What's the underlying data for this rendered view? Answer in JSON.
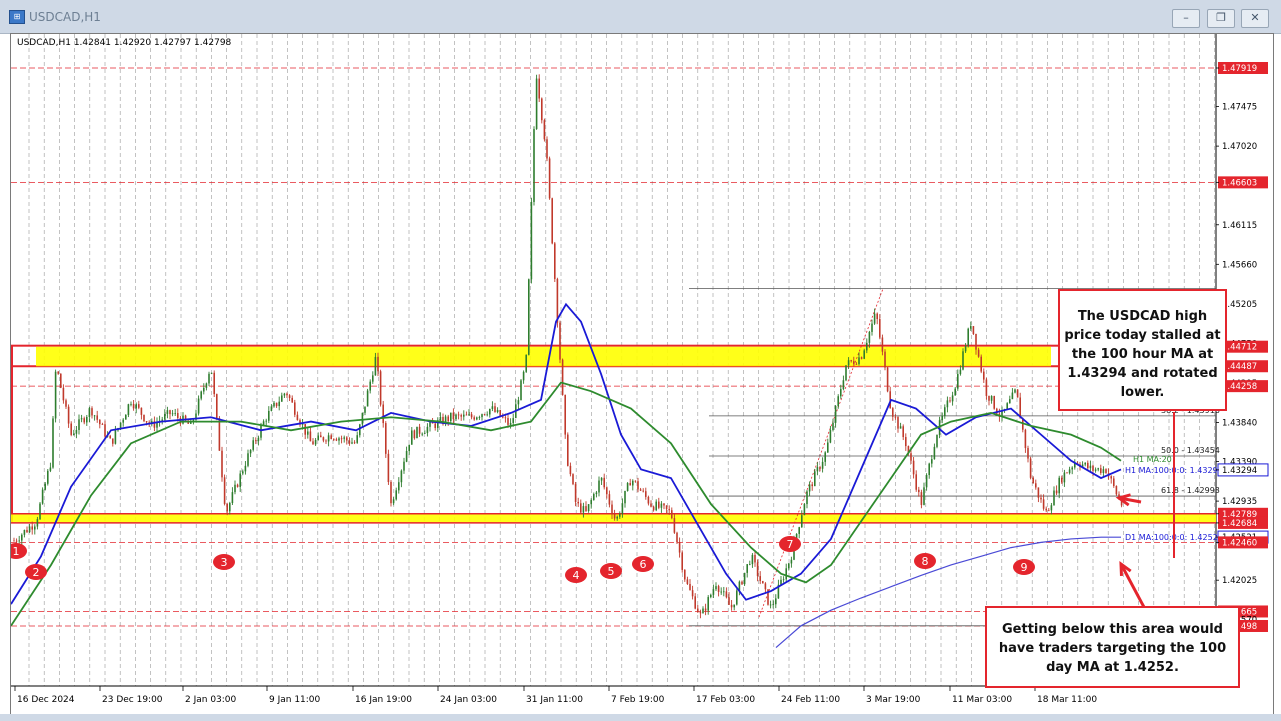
{
  "window": {
    "title": "USDCAD,H1",
    "minimize": "–",
    "restore": "❐",
    "close": "✕"
  },
  "chart": {
    "header": "USDCAD,H1  1.42841 1.42920 1.42797 1.42798",
    "price_axis": [
      {
        "label": "1.47919",
        "price": 1.47919,
        "highlight": "red"
      },
      {
        "label": "1.47475",
        "price": 1.47475
      },
      {
        "label": "1.47020",
        "price": 1.4702
      },
      {
        "label": "1.46603",
        "price": 1.46603,
        "highlight": "red"
      },
      {
        "label": "1.46115",
        "price": 1.46115
      },
      {
        "label": "1.45660",
        "price": 1.4566
      },
      {
        "label": "1.45205",
        "price": 1.45205
      },
      {
        "label": "1.44750",
        "price": 1.4475
      },
      {
        "label": "1.44712",
        "price": 1.44712,
        "highlight": "red"
      },
      {
        "label": "1.44487",
        "price": 1.44487,
        "highlight": "red"
      },
      {
        "label": "1.44295",
        "price": 1.44295
      },
      {
        "label": "1.44258",
        "price": 1.44258,
        "highlight": "red"
      },
      {
        "label": "1.43840",
        "price": 1.4384
      },
      {
        "label": "1.43390",
        "price": 1.4339
      },
      {
        "label": "1.43294",
        "price": 1.43294,
        "highlight": "blue-outline"
      },
      {
        "label": "1.42935",
        "price": 1.42935
      },
      {
        "label": "1.42789",
        "price": 1.42789,
        "highlight": "red"
      },
      {
        "label": "1.42684",
        "price": 1.42684,
        "highlight": "red"
      },
      {
        "label": "1.42521",
        "price": 1.42521,
        "highlight": "blue-outline"
      },
      {
        "label": "1.42460",
        "price": 1.4246,
        "highlight": "red"
      },
      {
        "label": "1.42025",
        "price": 1.42025
      },
      {
        "label": "1.41665",
        "price": 1.41665,
        "highlight": "red"
      },
      {
        "label": "1.41570",
        "price": 1.4157
      },
      {
        "label": "1.41498",
        "price": 1.41498,
        "highlight": "red"
      }
    ],
    "time_axis": [
      "16 Dec 2024",
      "23 Dec 19:00",
      "2 Jan 03:00",
      "9 Jan 11:00",
      "16 Jan 19:00",
      "24 Jan 03:00",
      "31 Jan 11:00",
      "7 Feb 19:00",
      "17 Feb 03:00",
      "24 Feb 11:00",
      "3 Mar 19:00",
      "11 Mar 03:00",
      "18 Mar 11:00"
    ],
    "horizontal_lines": [
      1.47919,
      1.46603,
      1.44258,
      1.4246,
      1.41665,
      1.41498
    ],
    "support_zone": {
      "from": 1.42684,
      "to": 1.42789
    },
    "resistance_zone": {
      "from": 1.44487,
      "to": 1.44712
    },
    "fibonacci": [
      {
        "label": "38.2 - 1.43916",
        "price": 1.43916
      },
      {
        "label": "50.0 - 1.43454",
        "price": 1.43454
      },
      {
        "label": "61.8 - 1.42993",
        "price": 1.42993
      }
    ],
    "ma_labels": [
      {
        "label": "H1 MA:20",
        "price": 1.4342,
        "color": "#2e8b2e"
      },
      {
        "label": "H1 MA:100:0:0: 1.43294",
        "price": 1.43294,
        "color": "#1a1ad6"
      },
      {
        "label": "D1 MA:100:0:0: 1.42521",
        "price": 1.42521,
        "color": "#1a1ad6"
      }
    ],
    "markers": [
      "1",
      "2",
      "3",
      "4",
      "5",
      "6",
      "7",
      "8",
      "9"
    ],
    "marker_color": "#e4252d"
  },
  "callouts": {
    "top": "The USDCAD high price today stalled at the 100 hour MA at 1.43294 and rotated lower.",
    "bottom": "Getting below this area would have traders targeting the 100 day MA at 1.4252."
  }
}
